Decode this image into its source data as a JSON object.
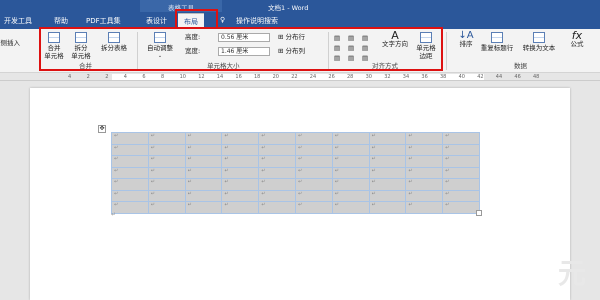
{
  "window": {
    "context_tab_label": "表格工具",
    "doc_title": "文档1  -  Word"
  },
  "tabs": [
    "开发工具",
    "帮助",
    "PDF工具集",
    "表设计",
    "布局",
    "操作说明搜索"
  ],
  "ribbon": {
    "insert_left": "在侧插入",
    "merge": {
      "merge_cells": "合并\n单元格",
      "split_cells": "拆分\n单元格",
      "split_table": "拆分表格",
      "group": "合并"
    },
    "cellsize": {
      "autofit": "自动调整",
      "height_label": "高度:",
      "height_value": "0.56 厘米",
      "width_label": "宽度:",
      "width_value": "1.46 厘米",
      "distribute_rows": "分布行",
      "distribute_cols": "分布列",
      "group": "单元格大小"
    },
    "align": {
      "text_direction": "文字方向",
      "cell_margins": "单元格\n边距",
      "group": "对齐方式"
    },
    "data": {
      "sort": "排序",
      "repeat_header": "重复标题行",
      "convert_text": "转换为文本",
      "formula": "公式",
      "group": "数据"
    }
  },
  "ruler": {
    "ticks": [
      "4",
      "2",
      "2",
      "4",
      "6",
      "8",
      "10",
      "12",
      "14",
      "16",
      "18",
      "20",
      "22",
      "24",
      "26",
      "28",
      "30",
      "32",
      "34",
      "36",
      "38",
      "40",
      "42",
      "44",
      "46",
      "48"
    ]
  },
  "table": {
    "rows": 7,
    "cols": 10,
    "cell_mark": "↵"
  },
  "paragraph_mark": "↵",
  "watermark": "元"
}
